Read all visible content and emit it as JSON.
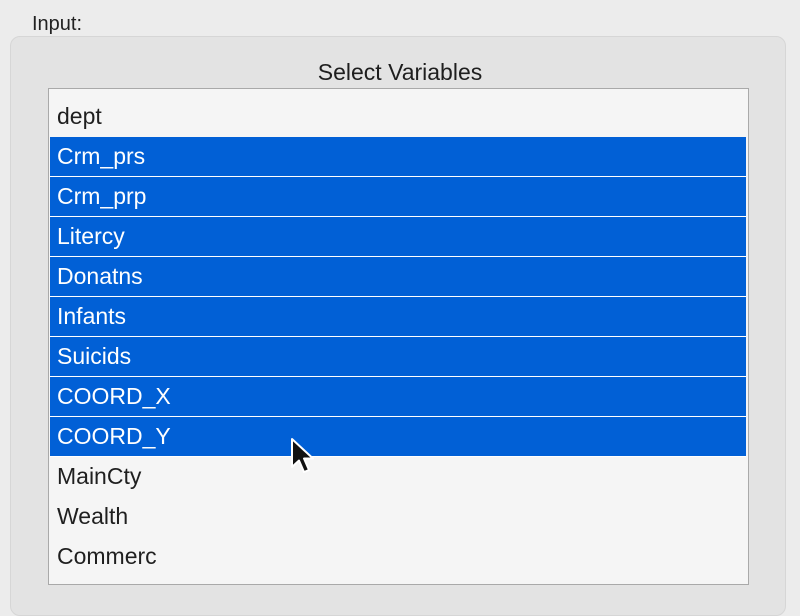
{
  "panel": {
    "input_label": "Input:",
    "list_title": "Select Variables"
  },
  "variables": [
    {
      "label": "dept",
      "selected": false
    },
    {
      "label": "Crm_prs",
      "selected": true
    },
    {
      "label": "Crm_prp",
      "selected": true
    },
    {
      "label": "Litercy",
      "selected": true
    },
    {
      "label": "Donatns",
      "selected": true
    },
    {
      "label": "Infants",
      "selected": true
    },
    {
      "label": "Suicids",
      "selected": true
    },
    {
      "label": "COORD_X",
      "selected": true
    },
    {
      "label": "COORD_Y",
      "selected": true
    },
    {
      "label": "MainCty",
      "selected": false
    },
    {
      "label": "Wealth",
      "selected": false
    },
    {
      "label": "Commerc",
      "selected": false
    }
  ],
  "colors": {
    "selection": "#0160d6",
    "list_background": "#f5f5f5",
    "panel_background": "#ececec"
  },
  "icons": {
    "cursor": "mouse-pointer-icon"
  }
}
